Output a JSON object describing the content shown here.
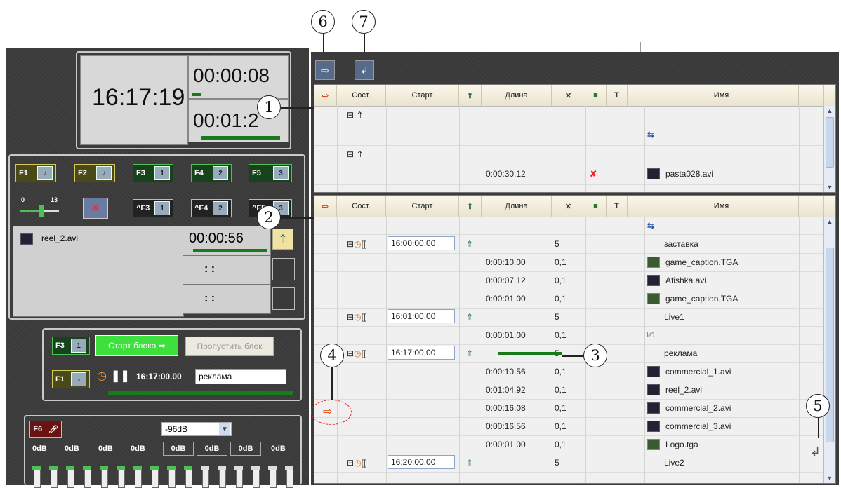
{
  "callouts": [
    "1",
    "2",
    "3",
    "4",
    "5",
    "6",
    "7"
  ],
  "clock": {
    "current_time": "16:17:19",
    "elapsed": "00:00:08",
    "remaining": "00:01:2_",
    "remaining_shown": "00:01:2"
  },
  "hotkeys": {
    "f1": "F1",
    "f2": "F2",
    "f3": "F3",
    "f4": "F4",
    "f5": "F5",
    "cf3": "^F3",
    "cf4": "^F4",
    "cf5": "^F5",
    "f3b": "F3",
    "f1b": "F1",
    "f6": "F6"
  },
  "slider": {
    "min": "0",
    "max": "13",
    "level": 0.55
  },
  "preview": {
    "file": "reel_2.avi",
    "time": "00:00:56",
    "empty1": ":  :",
    "empty2": ":  :"
  },
  "block": {
    "start_label": "Старт блока",
    "skip_label": "Пропустить блок",
    "time": "16:17:00.00",
    "name": "реклама"
  },
  "audio": {
    "level": "-96dB",
    "channels": [
      "0dB",
      "0dB",
      "0dB",
      "0dB",
      "0dB",
      "0dB",
      "0dB",
      "0dB"
    ]
  },
  "columns": [
    "Сост.",
    "Старт",
    "Длина",
    "Имя"
  ],
  "top_grid": {
    "rows": [
      {
        "start": "",
        "length": "",
        "n": "",
        "name": ""
      },
      {
        "start": "",
        "length": "",
        "n": "",
        "name": ""
      },
      {
        "start": "",
        "length": "",
        "n": "",
        "name": ""
      },
      {
        "start": "",
        "length": "0:00:30.12",
        "n": "",
        "name": "pasta028.avi"
      }
    ]
  },
  "bottom_grid": {
    "rows": [
      {
        "kind": "block",
        "start": "16:00:00.00",
        "length": "",
        "n": "5",
        "name": "заставка",
        "icon": ""
      },
      {
        "kind": "item",
        "start": "",
        "length": "0:00:10.00",
        "n": "0,1",
        "name": "game_caption.TGA",
        "icon": "image"
      },
      {
        "kind": "item",
        "start": "",
        "length": "0:00:07.12",
        "n": "0,1",
        "name": "Afishka.avi",
        "icon": "film"
      },
      {
        "kind": "item",
        "start": "",
        "length": "0:00:01.00",
        "n": "0,1",
        "name": "game_caption.TGA",
        "icon": "image"
      },
      {
        "kind": "block",
        "start": "16:01:00.00",
        "length": "",
        "n": "5",
        "name": "Live1",
        "icon": ""
      },
      {
        "kind": "item",
        "start": "",
        "length": "0:00:01.00",
        "n": "0,1",
        "name": "",
        "icon": "camera"
      },
      {
        "kind": "block",
        "start": "16:17:00.00",
        "length": "",
        "n": "5",
        "name": "реклама",
        "icon": ""
      },
      {
        "kind": "item",
        "start": "",
        "length": "0:00:10.56",
        "n": "0,1",
        "name": "commercial_1.avi",
        "icon": "film"
      },
      {
        "kind": "item",
        "start": "",
        "length": "0:01:04.92",
        "n": "0,1",
        "name": "reel_2.avi",
        "icon": "film"
      },
      {
        "kind": "item",
        "start": "",
        "length": "0:00:16.08",
        "n": "0,1",
        "name": "commercial_2.avi",
        "icon": "film"
      },
      {
        "kind": "item",
        "start": "",
        "length": "0:00:16.56",
        "n": "0,1",
        "name": "commercial_3.avi",
        "icon": "film"
      },
      {
        "kind": "item",
        "start": "",
        "length": "0:00:01.00",
        "n": "0,1",
        "name": "Logo.tga",
        "icon": "image"
      },
      {
        "kind": "block",
        "start": "16:20:00.00",
        "length": "",
        "n": "5",
        "name": "Live2",
        "icon": ""
      }
    ]
  }
}
